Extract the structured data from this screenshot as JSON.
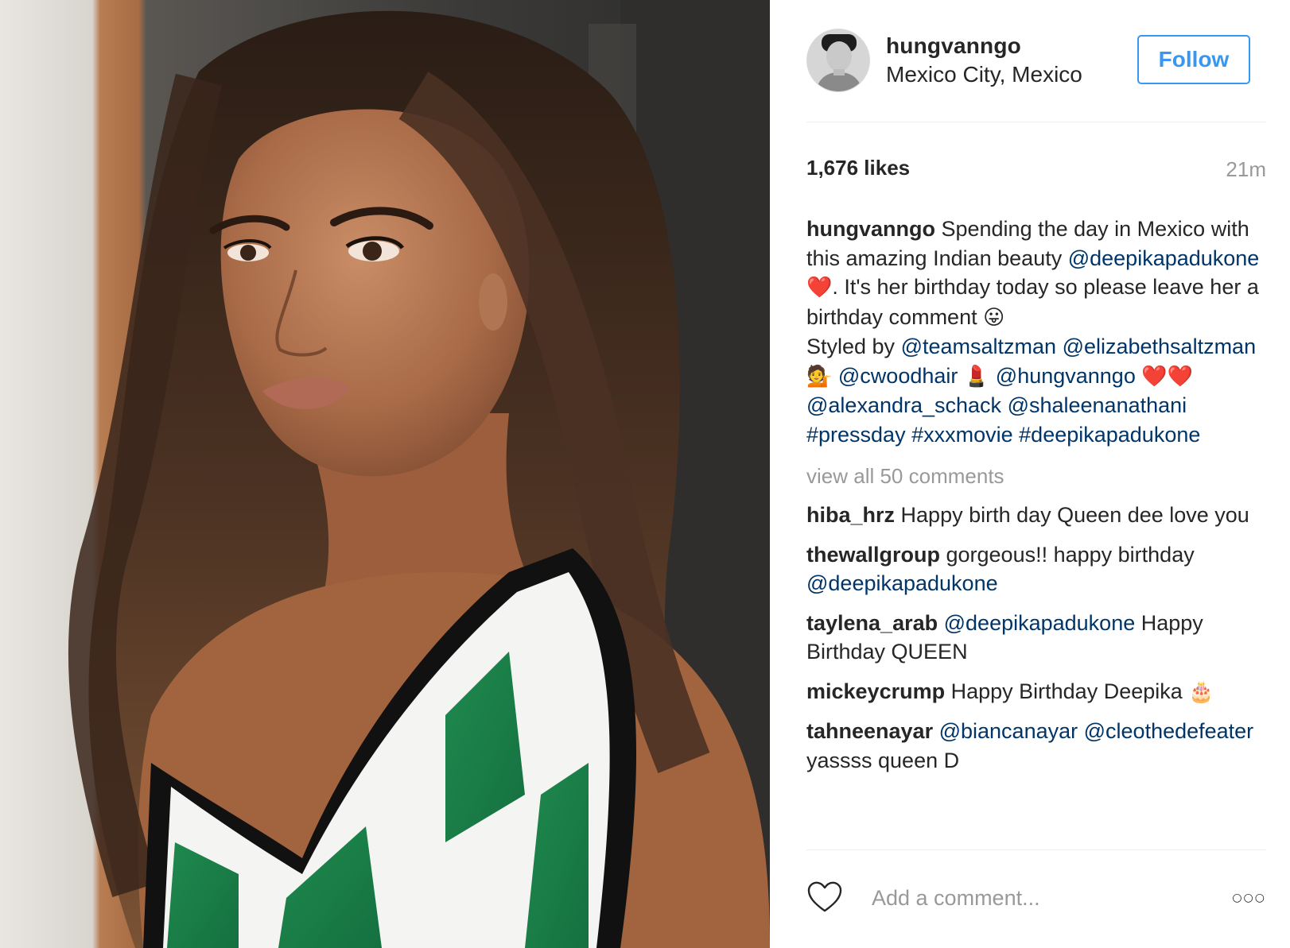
{
  "post": {
    "username": "hungvanngo",
    "location": "Mexico City, Mexico",
    "follow_label": "Follow",
    "likes": "1,676 likes",
    "time": "21m",
    "caption": {
      "username": "hungvanngo",
      "text_1": " Spending the day in Mexico with this amazing Indian beauty ",
      "mention_1": "@deepikapadukone",
      "emoji_1": "❤️",
      "text_2": ". It's her birthday today so please leave her a birthday comment ",
      "emoji_2": "😛",
      "text_3": "Styled by ",
      "mention_2": "@teamsaltzman",
      "mention_3": "@elizabethsaltzman",
      "emoji_3": "💁",
      "mention_4": "@cwoodhair",
      "emoji_4": "💄",
      "mention_5": "@hungvanngo",
      "emoji_5": "❤️❤️",
      "mention_6": "@alexandra_schack",
      "mention_7": "@shaleenanathani",
      "hashtag_1": "#pressday",
      "hashtag_2": "#xxxmovie",
      "hashtag_3": "#deepikapadukone"
    },
    "view_all_comments": "view all 50 comments",
    "comments": [
      {
        "user": "hiba_hrz",
        "text": " Happy birth day Queen dee love you"
      },
      {
        "user": "thewallgroup",
        "text": " gorgeous!! happy birthday ",
        "mention": "@deepikapadukone"
      },
      {
        "user": "taylena_arab",
        "mention": "@deepikapadukone",
        "text": " Happy Birthday QUEEN"
      },
      {
        "user": "mickeycrump",
        "text": " Happy Birthday Deepika ",
        "emoji": "🎂"
      },
      {
        "user": "tahneenayar",
        "mention": "@biancanayar",
        "mention_2": "@cleothedefeater",
        "text": " yassss queen D"
      }
    ],
    "add_comment_placeholder": "Add a comment...",
    "more_label": "○○○"
  },
  "colors": {
    "link": "#003569",
    "follow": "#3897f0",
    "muted": "#999999",
    "divider": "#efefef"
  },
  "icons": {
    "like": "heart-outline-icon",
    "more": "more-options-icon"
  }
}
